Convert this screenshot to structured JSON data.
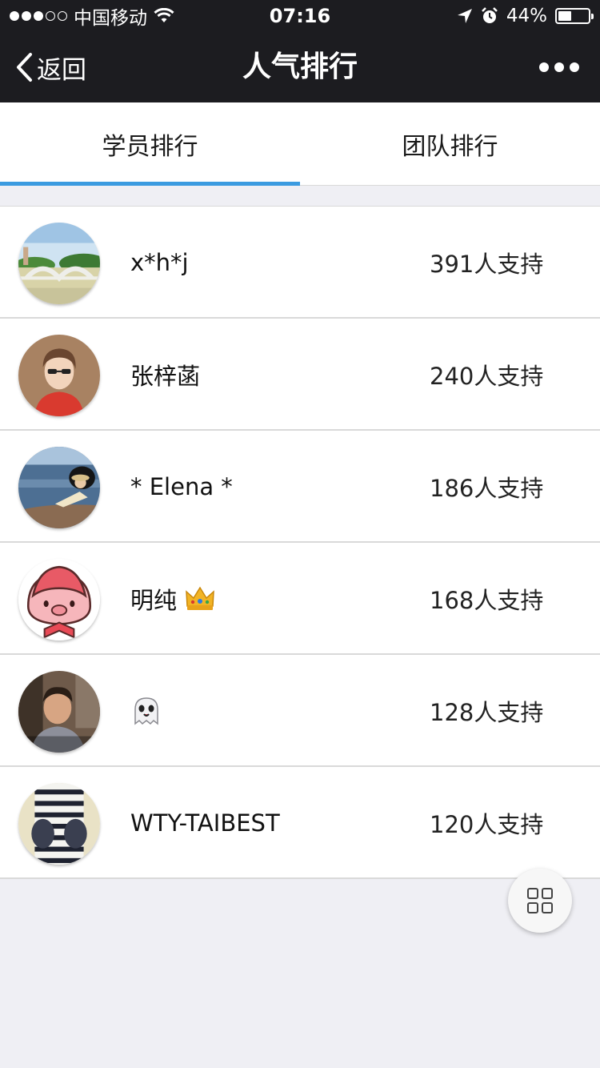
{
  "status_bar": {
    "carrier": "中国移动",
    "time": "07:16",
    "battery_percent": "44%",
    "battery_level": 0.44,
    "signal_bars": 3
  },
  "nav": {
    "back_label": "返回",
    "title": "人气排行"
  },
  "tabs": [
    {
      "label": "学员排行",
      "active": true
    },
    {
      "label": "团队排行",
      "active": false
    }
  ],
  "ranking": [
    {
      "name": "x*h*j",
      "support": "391人支持",
      "avatar": "bridge-landscape-avatar"
    },
    {
      "name": "张梓菡",
      "support": "240人支持",
      "avatar": "cartoon-girl-avatar"
    },
    {
      "name": "* Elena *",
      "support": "186人支持",
      "avatar": "seaside-avatar"
    },
    {
      "name": "明纯",
      "support": "168人支持",
      "avatar": "pink-pig-avatar",
      "badge": "crown-emoji"
    },
    {
      "name": "",
      "support": "128人支持",
      "avatar": "man-portrait-avatar",
      "badge": "ghost-emoji"
    },
    {
      "name": "WTY-TAIBEST",
      "support": "120人支持",
      "avatar": "striped-sweater-avatar"
    }
  ],
  "colors": {
    "bar_bg": "#1c1c20",
    "tab_indicator": "#3b9be0",
    "page_bg": "#efeff4"
  }
}
